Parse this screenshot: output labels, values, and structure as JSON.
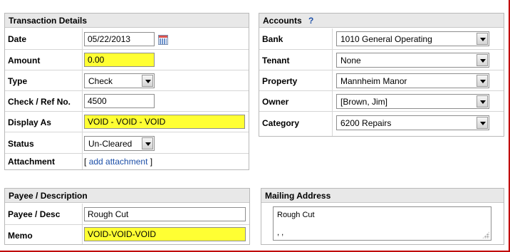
{
  "transaction": {
    "title": "Transaction Details",
    "date_label": "Date",
    "date_value": "05/22/2013",
    "amount_label": "Amount",
    "amount_value": "0.00",
    "type_label": "Type",
    "type_value": "Check",
    "checkref_label": "Check / Ref No.",
    "checkref_value": "4500",
    "displayas_label": "Display As",
    "displayas_value": "VOID - VOID - VOID",
    "status_label": "Status",
    "status_value": "Un-Cleared",
    "attachment_label": "Attachment",
    "attachment_open": "[",
    "attachment_link": "add attachment",
    "attachment_close": "]"
  },
  "accounts": {
    "title": "Accounts",
    "help": "?",
    "bank_label": "Bank",
    "bank_value": "1010 General Operating",
    "tenant_label": "Tenant",
    "tenant_value": "None",
    "property_label": "Property",
    "property_value": "Mannheim Manor",
    "owner_label": "Owner",
    "owner_value": "[Brown, Jim]",
    "category_label": "Category",
    "category_value": "6200 Repairs"
  },
  "payee": {
    "title": "Payee / Description",
    "payee_label": "Payee / Desc",
    "payee_value": "Rough Cut",
    "memo_label": "Memo",
    "memo_value": "VOID-VOID-VOID"
  },
  "mailing": {
    "title": "Mailing Address",
    "line1": "Rough Cut",
    "line2": ", ,"
  },
  "colors": {
    "highlight": "#ffff33",
    "link": "#1c4fa8",
    "frame": "#c00000"
  }
}
